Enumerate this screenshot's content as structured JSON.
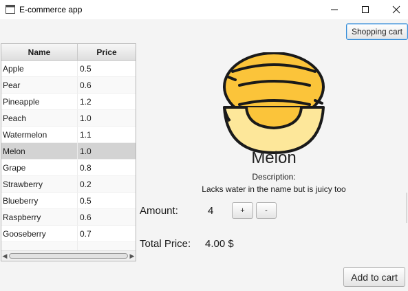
{
  "window": {
    "title": "E-commerce app",
    "icon": "window-app-icon",
    "controls": {
      "minimize": "minimize-icon",
      "maximize": "maximize-icon",
      "close": "close-icon"
    }
  },
  "toolbar": {
    "cart_label": "Shopping cart"
  },
  "table": {
    "columns": [
      "Name",
      "Price"
    ],
    "rows": [
      {
        "name": "Apple",
        "price": "0.5"
      },
      {
        "name": "Pear",
        "price": "0.6"
      },
      {
        "name": "Pineapple",
        "price": "1.2"
      },
      {
        "name": "Peach",
        "price": "1.0"
      },
      {
        "name": "Watermelon",
        "price": "1.1"
      },
      {
        "name": "Melon",
        "price": "1.0"
      },
      {
        "name": "Grape",
        "price": "0.8"
      },
      {
        "name": "Strawberry",
        "price": "0.2"
      },
      {
        "name": "Blueberry",
        "price": "0.5"
      },
      {
        "name": "Raspberry",
        "price": "0.6"
      },
      {
        "name": "Gooseberry",
        "price": "0.7"
      },
      {
        "name": "",
        "price": ""
      }
    ],
    "selected": "Melon"
  },
  "product": {
    "name": "Melon",
    "image": "melon-icon",
    "description_label": "Description:",
    "description": "Lacks water in the name but is juicy too",
    "amount_label": "Amount:",
    "amount": "4",
    "plus_label": "+",
    "minus_label": "-",
    "total_label": "Total Price:",
    "total": "4.00 $"
  },
  "actions": {
    "add_label": "Add to cart"
  },
  "colors": {
    "melon_fill": "#fbc43a",
    "melon_light": "#fde79a",
    "outline": "#1a1a1a",
    "selected_row": "#d3d3d3",
    "accent_border": "#3a8fd8"
  }
}
